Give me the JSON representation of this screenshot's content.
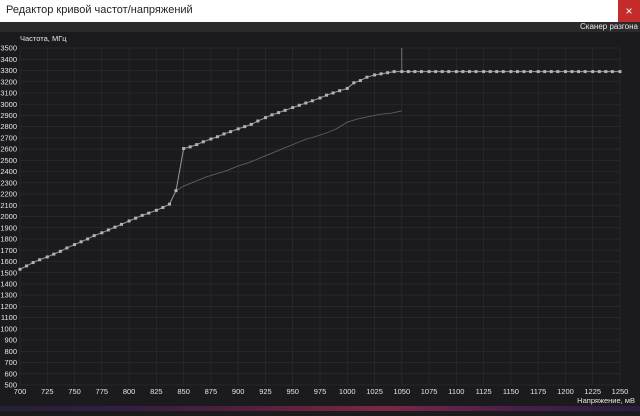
{
  "window": {
    "title": "Редактор кривой частот/напряжений",
    "close_glyph": "×"
  },
  "toolbar": {
    "scanner_label": "Сканер разгона"
  },
  "colors": {
    "bg": "#1b1b1d",
    "grid": "#2c2c2f",
    "curve": "#9a9a9a",
    "point": "#b4b4b4",
    "limit_line": "#8a8a8a",
    "ref_curve": "#5f5f5f",
    "text": "#e6e6e6",
    "close_button": "#c42b2b"
  },
  "chart_data": {
    "type": "line",
    "xlabel": "Напряжение, мВ",
    "ylabel": "Частота, МГц",
    "xlim": [
      700,
      1250
    ],
    "ylim": [
      500,
      3500
    ],
    "xticks": [
      700,
      725,
      750,
      775,
      800,
      825,
      850,
      875,
      900,
      925,
      950,
      975,
      1000,
      1025,
      1050,
      1075,
      1100,
      1125,
      1150,
      1175,
      1200,
      1225,
      1250
    ],
    "yticks": [
      500,
      600,
      700,
      800,
      900,
      1000,
      1100,
      1200,
      1300,
      1400,
      1500,
      1600,
      1700,
      1800,
      1900,
      2000,
      2100,
      2200,
      2300,
      2400,
      2500,
      2600,
      2700,
      2800,
      2900,
      3000,
      3100,
      3200,
      3300,
      3400,
      3500
    ],
    "grid": true,
    "limit_voltage": 1050,
    "series": [
      {
        "x": [
          700,
          706,
          712,
          718,
          725,
          731,
          737,
          743,
          750,
          756,
          762,
          768,
          775,
          781,
          787,
          793,
          800,
          806,
          812,
          818,
          825,
          831,
          837,
          843,
          850,
          856,
          862,
          868,
          875,
          881,
          887,
          893,
          900,
          906,
          912,
          918,
          925,
          931,
          937,
          943,
          950,
          956,
          962,
          968,
          975,
          981,
          987,
          993,
          1000,
          1006,
          1012,
          1018,
          1025,
          1031,
          1037,
          1043,
          1050,
          1056,
          1062,
          1068,
          1075,
          1081,
          1087,
          1093,
          1100,
          1106,
          1112,
          1118,
          1125,
          1131,
          1137,
          1143,
          1150,
          1156,
          1162,
          1168,
          1175,
          1181,
          1187,
          1193,
          1200,
          1206,
          1212,
          1218,
          1225,
          1231,
          1237,
          1243,
          1250
        ],
        "y": [
          1530,
          1560,
          1590,
          1615,
          1640,
          1665,
          1690,
          1720,
          1750,
          1775,
          1800,
          1830,
          1855,
          1880,
          1905,
          1930,
          1960,
          1985,
          2010,
          2030,
          2055,
          2080,
          2110,
          2230,
          2605,
          2620,
          2640,
          2665,
          2690,
          2710,
          2735,
          2755,
          2780,
          2800,
          2820,
          2850,
          2880,
          2905,
          2925,
          2945,
          2970,
          2990,
          3010,
          3030,
          3055,
          3080,
          3100,
          3120,
          3140,
          3190,
          3210,
          3240,
          3260,
          3270,
          3280,
          3290,
          3290,
          3290,
          3290,
          3290,
          3290,
          3290,
          3290,
          3290,
          3290,
          3290,
          3290,
          3290,
          3290,
          3290,
          3290,
          3290,
          3290,
          3290,
          3290,
          3290,
          3290,
          3290,
          3290,
          3290,
          3290,
          3290,
          3290,
          3290,
          3290,
          3290,
          3290,
          3290,
          3290
        ]
      },
      {
        "x": [
          843,
          850,
          860,
          870,
          880,
          890,
          900,
          910,
          920,
          930,
          940,
          950,
          960,
          970,
          980,
          990,
          1000,
          1010,
          1020,
          1030,
          1040,
          1050
        ],
        "y": [
          2230,
          2270,
          2310,
          2350,
          2380,
          2410,
          2450,
          2480,
          2520,
          2560,
          2600,
          2640,
          2680,
          2710,
          2740,
          2780,
          2840,
          2870,
          2890,
          2910,
          2920,
          2940
        ]
      }
    ]
  }
}
